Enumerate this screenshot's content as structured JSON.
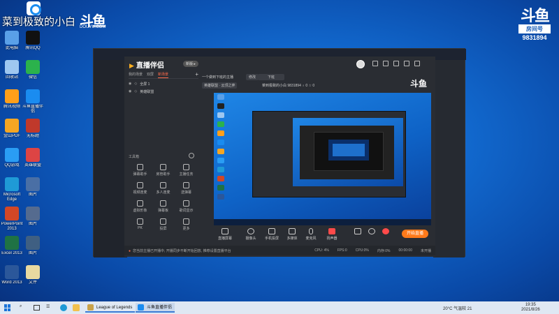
{
  "overlay": {
    "streamer_name": "菜到极致的小白",
    "douyu_logo": "斗鱼",
    "douyu_sub": "DOUYU.COM",
    "room_badge": {
      "logo": "斗鱼",
      "label": "房间号",
      "number": "9831894"
    }
  },
  "desktop_icons": [
    {
      "label": "此电脑",
      "color": "#5aa0e8"
    },
    {
      "label": "腾讯QQ",
      "color": "#111111"
    },
    {
      "label": "回收站",
      "color": "#9ec7f0"
    },
    {
      "label": "微信",
      "color": "#2bb24c"
    },
    {
      "label": "腾讯视频",
      "color": "#ff9f1a"
    },
    {
      "label": "斗鱼直播伴侣",
      "color": "#1a8cf0"
    },
    {
      "label": "金山PDF",
      "color": "#f5a623"
    },
    {
      "label": "无标题",
      "color": "#c0392b"
    },
    {
      "label": "QQ游戏",
      "color": "#2a9df4"
    },
    {
      "label": "英雄联盟",
      "color": "#d44"
    },
    {
      "label": "Microsoft Edge",
      "color": "#1f9ad6"
    },
    {
      "label": "图片",
      "color": "#4a6fa5"
    },
    {
      "label": "PowerPoint 2013",
      "color": "#d24726"
    },
    {
      "label": "图片",
      "color": "#556b8f"
    },
    {
      "label": "Excel 2013",
      "color": "#1f7244"
    },
    {
      "label": "图片",
      "color": "#3f5f82"
    },
    {
      "label": "Word 2013",
      "color": "#2b579a"
    },
    {
      "label": "文件",
      "color": "#e8d9a0"
    }
  ],
  "app": {
    "brand": "直播伴侣",
    "version_pill": "新版 ▸",
    "scene_tabs": [
      "我的场景",
      "双屏",
      "新场景"
    ],
    "scenes": [
      {
        "label": "全屏 1"
      },
      {
        "label": "英雄联盟"
      }
    ],
    "tools_heading": "工具箱",
    "tools": [
      {
        "label": "弹幕助手"
      },
      {
        "label": "房管助手"
      },
      {
        "label": "主播任务"
      },
      {
        "label": "视频连麦"
      },
      {
        "label": "多人连麦"
      },
      {
        "label": "送弹幕"
      },
      {
        "label": "虚拟形象"
      },
      {
        "label": "弹幕板"
      },
      {
        "label": "歌词显示"
      },
      {
        "label": "PK"
      },
      {
        "label": "投屏"
      },
      {
        "label": "更多"
      }
    ],
    "live_title": "一个做到下班的主播",
    "category_btn": "修改",
    "quality_btn": "下班",
    "game_pill": "英雄联盟 · 云顶之弈",
    "meta": "菜到极致的小白   9831894   ♁ 0   ☆ 0",
    "room_logo": "斗鱼",
    "toolbar": [
      {
        "label": "直播屏幕"
      },
      {
        "label": "摄像头"
      },
      {
        "label": "手机投屏"
      },
      {
        "label": "多媒体"
      },
      {
        "label": "麦克风"
      },
      {
        "label": "扬声器"
      }
    ],
    "start_button": "开始直播",
    "status_left": "您当前主播已开播中, 开播同步不断开始回放, 推荐设置直播平台",
    "status_right": [
      "CPU: 4%",
      "FPS:0",
      "CPU:0%",
      "内存:0%",
      "00:00:00",
      "未开播"
    ]
  },
  "taskbar": {
    "apps": [
      {
        "label": "League of Legends",
        "color": "#c8a24a"
      },
      {
        "label": "斗鱼直播伴侣",
        "color": "#1a8cf0"
      }
    ],
    "weather": "20°C 气温较 21",
    "time": "19:35",
    "date": "2021/8/26"
  }
}
